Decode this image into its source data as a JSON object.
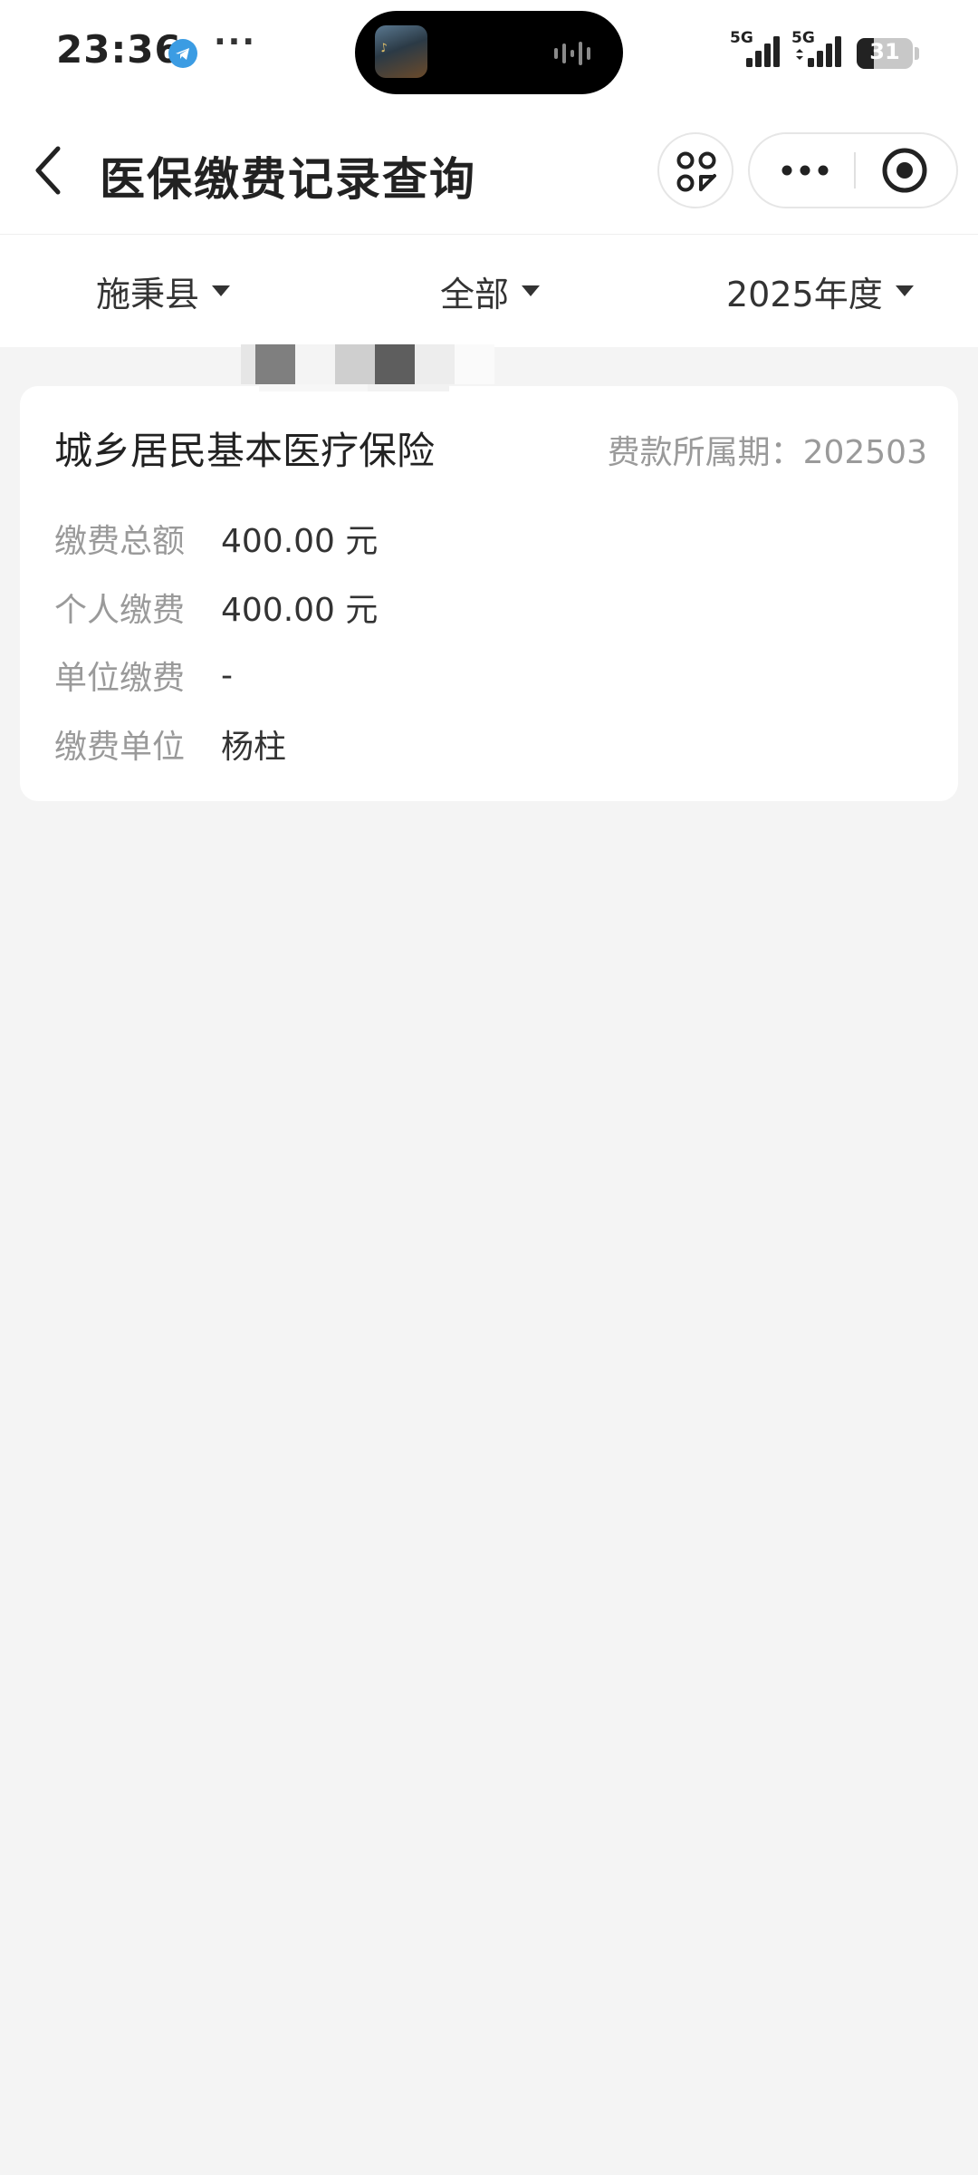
{
  "status_bar": {
    "time": "23:36",
    "more": "···",
    "network_1": "5G",
    "network_2": "5G",
    "battery_level": "31",
    "battery_fraction": 0.31
  },
  "nav": {
    "title": "医保缴费记录查询"
  },
  "filters": {
    "region": "施秉县",
    "category": "全部",
    "year": "2025年度"
  },
  "record": {
    "title": "城乡居民基本医疗保险",
    "period": "费款所属期：202503",
    "fields": [
      {
        "label": "缴费总额",
        "value": "400.00 元"
      },
      {
        "label": "个人缴费",
        "value": "400.00 元"
      },
      {
        "label": "单位缴费",
        "value": "-"
      },
      {
        "label": "缴费单位",
        "value": "杨柱"
      }
    ]
  },
  "colors": {
    "background": "#f4f4f4",
    "card": "#ffffff",
    "label": "#9a9a9a",
    "text": "#333333",
    "telegram": "#3b9ce3"
  },
  "icons": [
    "telegram-icon",
    "back-arrow-icon",
    "scan-icon",
    "more-icon",
    "close-target-icon",
    "caret-down-icon"
  ]
}
